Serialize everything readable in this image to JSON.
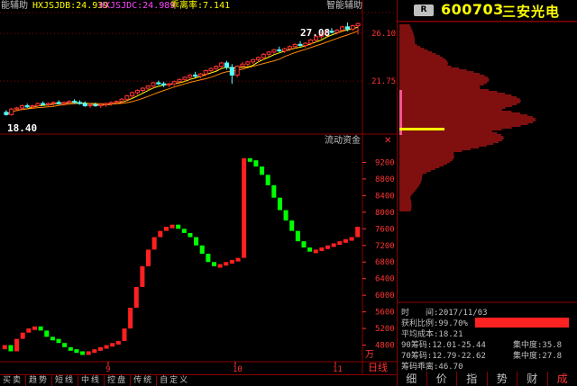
{
  "top_bar": {
    "left_label": "能辅助",
    "indicator_1": "HXJSJDB:24.939",
    "indicator_2": "HXJSJDC:24.989",
    "indicator_3": "乖离率:7.141",
    "right_label": "智能辅助"
  },
  "price_panel": {
    "high_label": "27.08",
    "low_label": "18.40",
    "ticks": [
      "26.10",
      "21.75"
    ]
  },
  "flow_panel": {
    "title": "流动资金",
    "ticks": [
      "9200",
      "8800",
      "8400",
      "8000",
      "7600",
      "7200",
      "6800",
      "6400",
      "6000",
      "5600",
      "5200",
      "4800"
    ],
    "unit": "万"
  },
  "x_axis": {
    "labels": [
      "9",
      "10",
      "11"
    ]
  },
  "period_label": "日线",
  "bottom_tabs": [
    "买卖",
    "趋势",
    "短线",
    "中线",
    "控盘",
    "传统",
    "自定义"
  ],
  "stock": {
    "badge": "R",
    "code": "600703",
    "name": "三安光电"
  },
  "chip_panel": {
    "price_ticks": [
      "26.10",
      "21.75"
    ],
    "time_label": "时　　间:2017/11/03",
    "profit_ratio_label": "获利比例:99.70%",
    "avg_cost": "平均成本:18.21",
    "chip90": "90筹码:12.01-25.44",
    "concentration90": "集中度:35.8",
    "chip70": "70筹码:12.79-22.62",
    "concentration70": "集中度:27.8",
    "deviation": "筹码乖离:46.70"
  },
  "side_tabs": [
    "细",
    "价",
    "指",
    "势",
    "财",
    "成"
  ],
  "colors": {
    "up": "#ff3333",
    "down": "#54ffff",
    "flow_up": "#ff2020",
    "flow_down": "#00ff00",
    "grid": "#8b0000",
    "ma1": "#ffff00",
    "ma2": "#ff8800"
  },
  "chart_data": [
    {
      "type": "candlestick",
      "title": "",
      "ylim": [
        17.0,
        28.0
      ],
      "ohlc": [
        [
          18.9,
          19.1,
          18.6,
          18.7
        ],
        [
          18.7,
          19.3,
          18.6,
          19.2
        ],
        [
          19.2,
          19.4,
          19.0,
          19.3
        ],
        [
          19.3,
          19.6,
          19.1,
          19.5
        ],
        [
          19.5,
          19.7,
          19.3,
          19.4
        ],
        [
          19.4,
          19.6,
          19.2,
          19.5
        ],
        [
          19.5,
          19.8,
          19.4,
          19.7
        ],
        [
          19.7,
          19.9,
          19.5,
          19.6
        ],
        [
          19.6,
          19.8,
          19.4,
          19.7
        ],
        [
          19.7,
          19.9,
          19.5,
          19.8
        ],
        [
          19.8,
          20.0,
          19.6,
          19.7
        ],
        [
          19.7,
          19.9,
          19.5,
          19.8
        ],
        [
          19.8,
          20.0,
          19.6,
          19.9
        ],
        [
          19.9,
          20.1,
          19.7,
          19.8
        ],
        [
          19.8,
          20.0,
          19.6,
          19.7
        ],
        [
          19.7,
          19.9,
          19.4,
          19.5
        ],
        [
          19.5,
          19.7,
          19.3,
          19.6
        ],
        [
          19.6,
          19.8,
          19.4,
          19.5
        ],
        [
          19.5,
          19.7,
          19.3,
          19.6
        ],
        [
          19.6,
          19.8,
          19.4,
          19.7
        ],
        [
          19.7,
          19.9,
          19.5,
          19.8
        ],
        [
          19.8,
          20.0,
          19.6,
          19.9
        ],
        [
          19.9,
          20.2,
          19.7,
          20.1
        ],
        [
          20.1,
          20.5,
          19.9,
          20.4
        ],
        [
          20.4,
          20.8,
          20.2,
          20.7
        ],
        [
          20.7,
          21.0,
          20.5,
          20.9
        ],
        [
          20.9,
          21.2,
          20.7,
          21.1
        ],
        [
          21.1,
          21.4,
          20.9,
          21.3
        ],
        [
          21.3,
          21.7,
          21.1,
          21.6
        ],
        [
          21.6,
          21.8,
          21.4,
          21.5
        ],
        [
          21.5,
          21.7,
          21.2,
          21.4
        ],
        [
          21.4,
          21.6,
          21.2,
          21.5
        ],
        [
          21.5,
          21.8,
          21.3,
          21.7
        ],
        [
          21.7,
          22.0,
          21.5,
          21.9
        ],
        [
          21.9,
          22.2,
          21.7,
          22.1
        ],
        [
          22.1,
          22.4,
          21.9,
          22.3
        ],
        [
          22.3,
          22.6,
          22.1,
          22.2
        ],
        [
          22.2,
          22.5,
          22.0,
          22.4
        ],
        [
          22.4,
          22.8,
          22.2,
          22.7
        ],
        [
          22.7,
          23.0,
          22.5,
          22.9
        ],
        [
          22.9,
          23.2,
          22.7,
          23.1
        ],
        [
          23.1,
          23.5,
          22.9,
          23.4
        ],
        [
          23.4,
          23.6,
          22.8,
          23.0
        ],
        [
          23.0,
          23.3,
          21.5,
          22.3
        ],
        [
          22.3,
          23.2,
          22.1,
          23.1
        ],
        [
          23.1,
          23.5,
          22.9,
          23.3
        ],
        [
          23.3,
          23.6,
          23.1,
          23.5
        ],
        [
          23.5,
          23.8,
          23.3,
          23.7
        ],
        [
          23.7,
          24.0,
          23.5,
          23.9
        ],
        [
          23.9,
          24.3,
          23.7,
          24.2
        ],
        [
          24.2,
          24.5,
          24.0,
          24.4
        ],
        [
          24.4,
          24.7,
          24.2,
          24.6
        ],
        [
          24.6,
          24.9,
          24.4,
          24.5
        ],
        [
          24.5,
          24.8,
          24.3,
          24.7
        ],
        [
          24.7,
          25.0,
          24.5,
          24.9
        ],
        [
          24.9,
          25.2,
          24.7,
          25.1
        ],
        [
          25.1,
          25.4,
          24.9,
          25.0
        ],
        [
          25.0,
          25.3,
          24.8,
          25.2
        ],
        [
          25.2,
          25.6,
          25.0,
          25.5
        ],
        [
          25.5,
          25.9,
          25.3,
          25.8
        ],
        [
          25.8,
          26.1,
          25.6,
          26.0
        ],
        [
          26.0,
          26.4,
          25.8,
          26.3
        ],
        [
          26.3,
          26.6,
          26.1,
          26.2
        ],
        [
          26.2,
          26.5,
          26.0,
          26.4
        ],
        [
          26.4,
          26.8,
          26.2,
          26.7
        ],
        [
          26.7,
          27.1,
          26.3,
          26.5
        ],
        [
          26.5,
          26.9,
          26.3,
          26.8
        ],
        [
          26.8,
          27.08,
          26.0,
          27.0
        ]
      ]
    },
    {
      "type": "bar",
      "title": "流动资金",
      "ylim": [
        4400,
        9600
      ],
      "values": [
        4800,
        4650,
        4950,
        5100,
        5200,
        5250,
        5150,
        5000,
        4950,
        4850,
        4750,
        4700,
        4650,
        4600,
        4650,
        4700,
        4750,
        4800,
        4850,
        4900,
        5200,
        5700,
        6200,
        6700,
        7100,
        7400,
        7550,
        7650,
        7700,
        7600,
        7500,
        7400,
        7200,
        7000,
        6800,
        6700,
        6750,
        6800,
        6850,
        6900,
        9300,
        9250,
        9100,
        8900,
        8650,
        8350,
        8050,
        7800,
        7550,
        7300,
        7150,
        7050,
        7100,
        7150,
        7200,
        7250,
        7300,
        7350,
        7400,
        7650
      ]
    }
  ]
}
